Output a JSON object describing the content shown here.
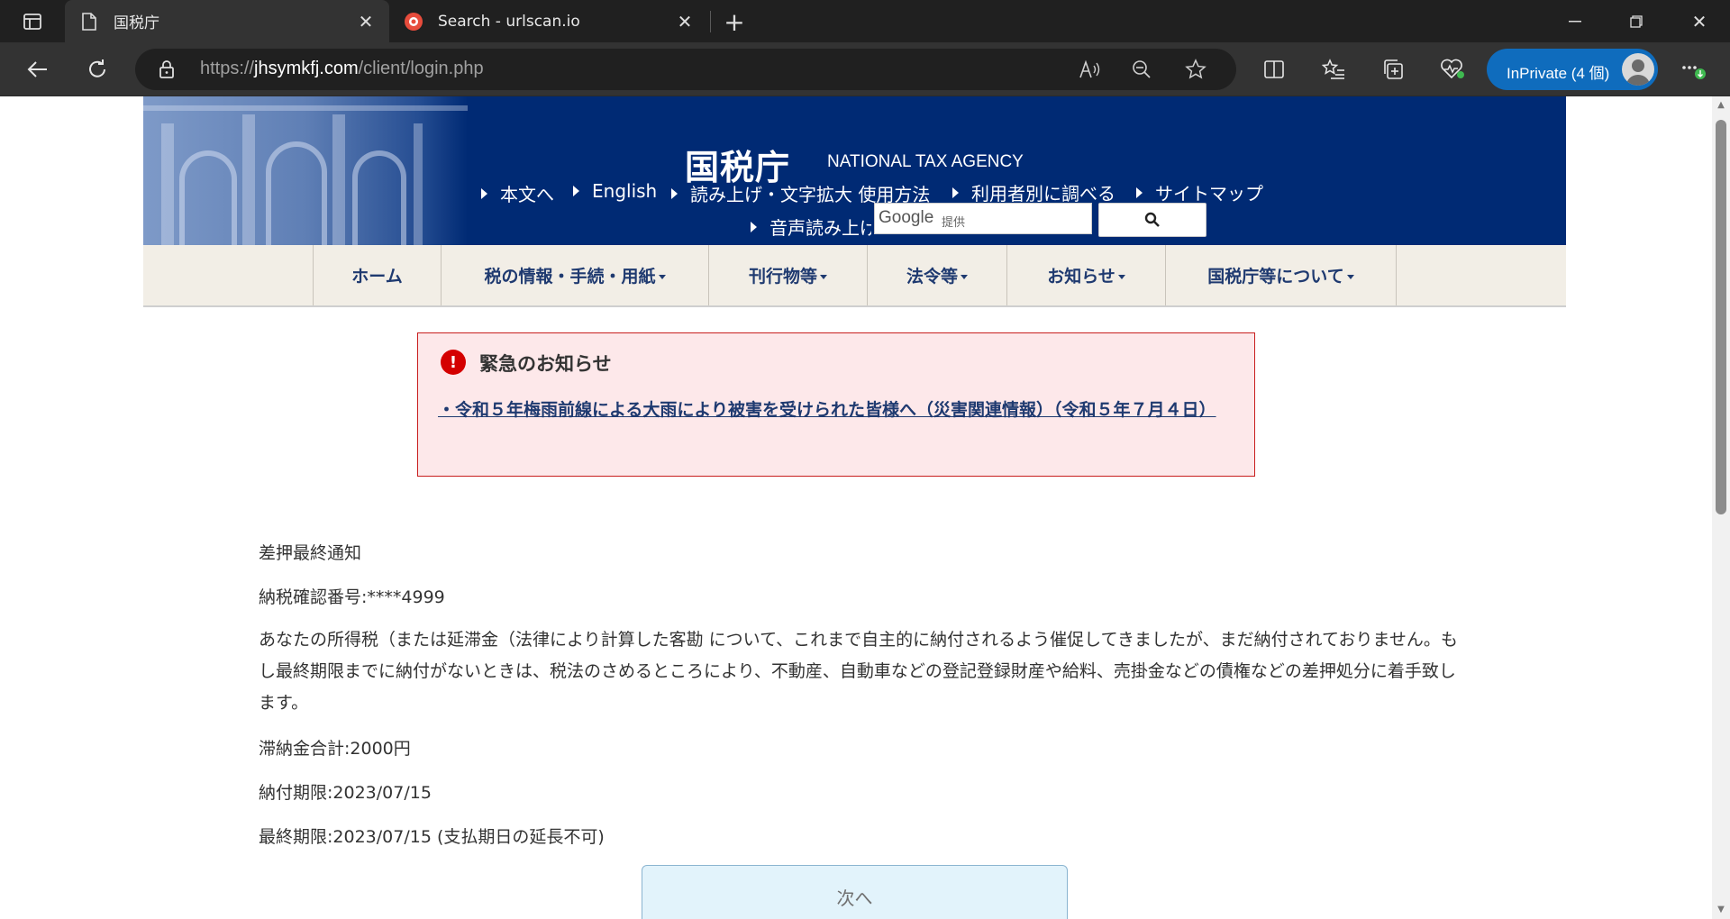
{
  "browser": {
    "tabs": [
      {
        "title": "国税庁",
        "active": true
      },
      {
        "title": "Search - urlscan.io",
        "active": false
      }
    ],
    "address": {
      "scheme": "https://",
      "host": "jhsymkfj.com",
      "path": "/client/login.php"
    },
    "profile_label": "InPrivate (4 個)"
  },
  "header": {
    "logo": "国税庁",
    "logo_en": "NATIONAL TAX AGENCY",
    "links": [
      "本文へ",
      "English",
      "読み上げ・文字拡大 使用方法",
      "利用者別に調べる",
      "サイトマップ",
      "音声読み上げ"
    ],
    "search": {
      "google_label": "Google",
      "provided_label": "提供"
    }
  },
  "nav": {
    "items": [
      "ホーム",
      "税の情報・手続・用紙",
      "刊行物等",
      "法令等",
      "お知らせ",
      "国税庁等について"
    ]
  },
  "notice": {
    "title": "緊急のお知らせ",
    "link": "・令和５年梅雨前線による大雨により被害を受けられた皆様へ（災害関連情報）（令和５年７月４日）"
  },
  "content": {
    "heading": "差押最終通知",
    "confirmation": "納税確認番号:****4999",
    "paragraph": "あなたの所得税（または延滞金（法律により計算した客勘 について、これまで自主的に納付されるよう催促してきましたが、まだ納付されておりません。もし最終期限までに納付がないときは、税法のさめるところにより、不動産、自動車などの登記登録財産や給料、売掛金などの債権などの差押処分に着手致します。",
    "total": "滞納金合計:2000円",
    "due": "納付期限:2023/07/15",
    "final": "最終期限:2023/07/15 (支払期日の延長不可)",
    "next_button": "次へ"
  },
  "colors": {
    "header_bg": "#002a74",
    "nav_bg": "#f2eee6",
    "notice_bg": "#fde8ea",
    "notice_border": "#c81e1e",
    "inprivate": "#0f6cbd"
  }
}
